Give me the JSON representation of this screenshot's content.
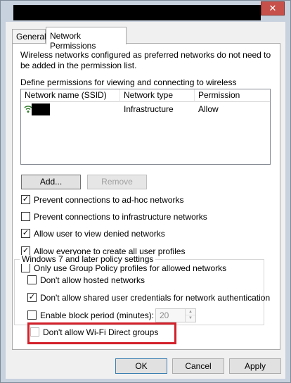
{
  "window": {
    "close_glyph": "✕"
  },
  "tabs": [
    {
      "label": "General"
    },
    {
      "label": "Network Permissions"
    }
  ],
  "panel": {
    "description": "Wireless networks configured as preferred networks do not need to be added in the permission list.",
    "define_label": "Define permissions for viewing and connecting to wireless networks:",
    "list": {
      "columns": [
        "Network name (SSID)",
        "Network type",
        "Permission"
      ],
      "rows": [
        {
          "icon": "wifi-network-icon",
          "type": "Infrastructure",
          "permission": "Allow"
        }
      ]
    },
    "add_label": "Add...",
    "remove_label": "Remove",
    "checkboxes": [
      {
        "label": "Prevent connections to ad-hoc networks",
        "checked": true
      },
      {
        "label": "Prevent connections to infrastructure networks",
        "checked": false
      },
      {
        "label": "Allow user to view denied networks",
        "checked": true
      },
      {
        "label": "Allow everyone to create all user profiles",
        "checked": true
      },
      {
        "label": "Only use Group Policy profiles for allowed networks",
        "checked": false
      }
    ],
    "group": {
      "title": "Windows 7 and later policy settings",
      "checkboxes": [
        {
          "label": "Don't allow hosted networks",
          "checked": false
        },
        {
          "label": "Don't allow shared user credentials for network authentication",
          "checked": true
        },
        {
          "label": "Enable block period (minutes):",
          "checked": false
        },
        {
          "label": "Don't allow Wi-Fi Direct groups",
          "checked": false
        }
      ],
      "block_period_value": "20"
    }
  },
  "buttons": {
    "ok": "OK",
    "cancel": "Cancel",
    "apply": "Apply"
  },
  "colors": {
    "highlight": "#d3202a",
    "titlebar": "#c8d1de",
    "close_button": "#c7504a"
  }
}
